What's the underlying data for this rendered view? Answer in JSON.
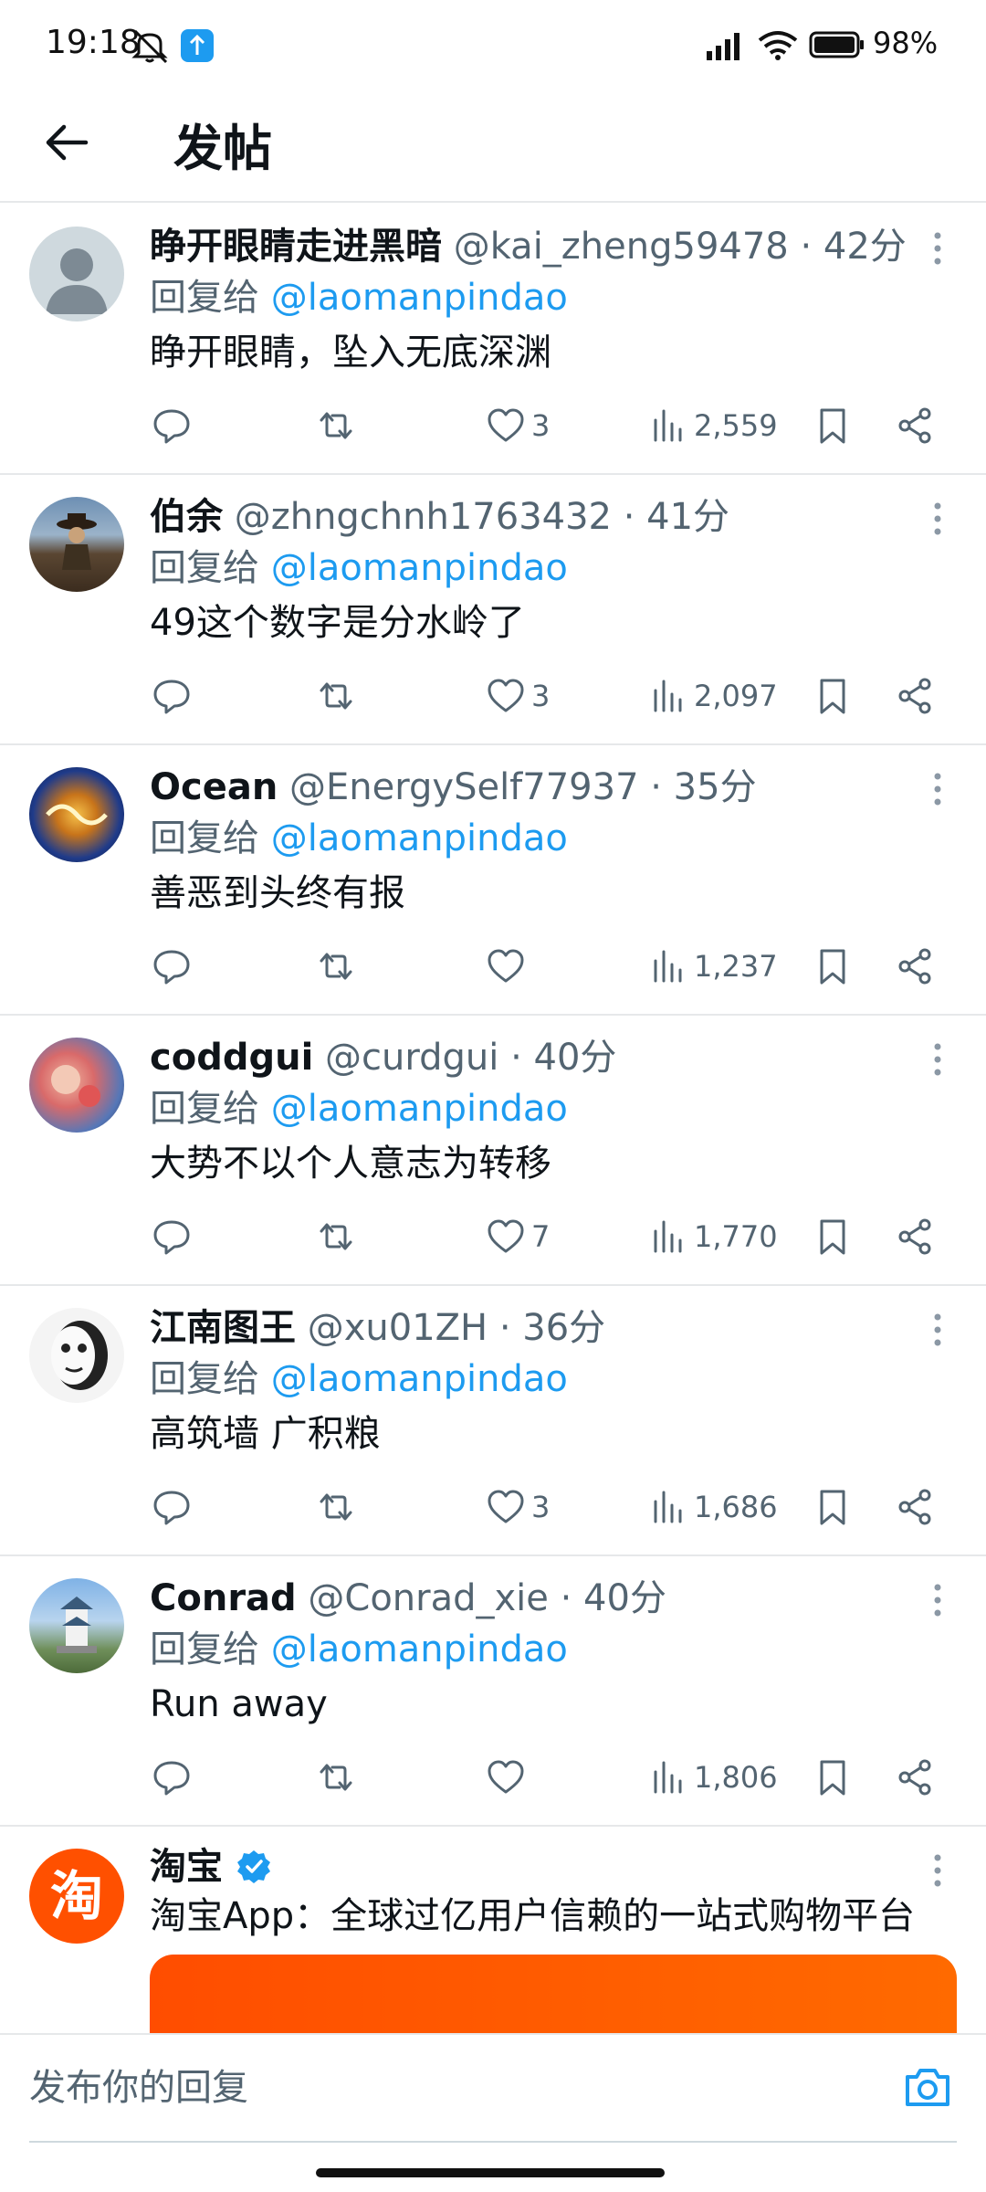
{
  "status_bar": {
    "time": "19:18",
    "battery": "98%"
  },
  "header": {
    "title": "发帖"
  },
  "reply_prefix": "回复给",
  "posts": [
    {
      "name": "睁开眼睛走进黑暗",
      "handle": "@kai_zheng59478",
      "time": "42分",
      "reply_to": "@laomanpindao",
      "text": "睁开眼睛，坠入无底深渊",
      "likes": "3",
      "views": "2,559"
    },
    {
      "name": "伯余",
      "handle": "@zhngchnh1763432",
      "time": "41分",
      "reply_to": "@laomanpindao",
      "text": "49这个数字是分水岭了",
      "likes": "3",
      "views": "2,097"
    },
    {
      "name": "Ocean",
      "handle": "@EnergySelf77937",
      "time": "35分",
      "reply_to": "@laomanpindao",
      "text": "善恶到头终有报",
      "likes": "",
      "views": "1,237"
    },
    {
      "name": "coddgui",
      "handle": "@curdgui",
      "time": "40分",
      "reply_to": "@laomanpindao",
      "text": "大势不以个人意志为转移",
      "likes": "7",
      "views": "1,770"
    },
    {
      "name": "江南图王",
      "handle": "@xu01ZH",
      "time": "36分",
      "reply_to": "@laomanpindao",
      "text": "高筑墙 广积粮",
      "likes": "3",
      "views": "1,686"
    },
    {
      "name": "Conrad",
      "handle": "@Conrad_xie",
      "time": "40分",
      "reply_to": "@laomanpindao",
      "text": "Run away",
      "likes": "",
      "views": "1,806"
    }
  ],
  "ad": {
    "name": "淘宝",
    "avatar_glyph": "淘",
    "text": "淘宝App：全球过亿用户信赖的一站式购物平台"
  },
  "composer": {
    "placeholder": "发布你的回复"
  },
  "colors": {
    "accent": "#1d9bf0",
    "muted": "#536471",
    "text": "#0f1419",
    "taobao": "#ff5000"
  }
}
